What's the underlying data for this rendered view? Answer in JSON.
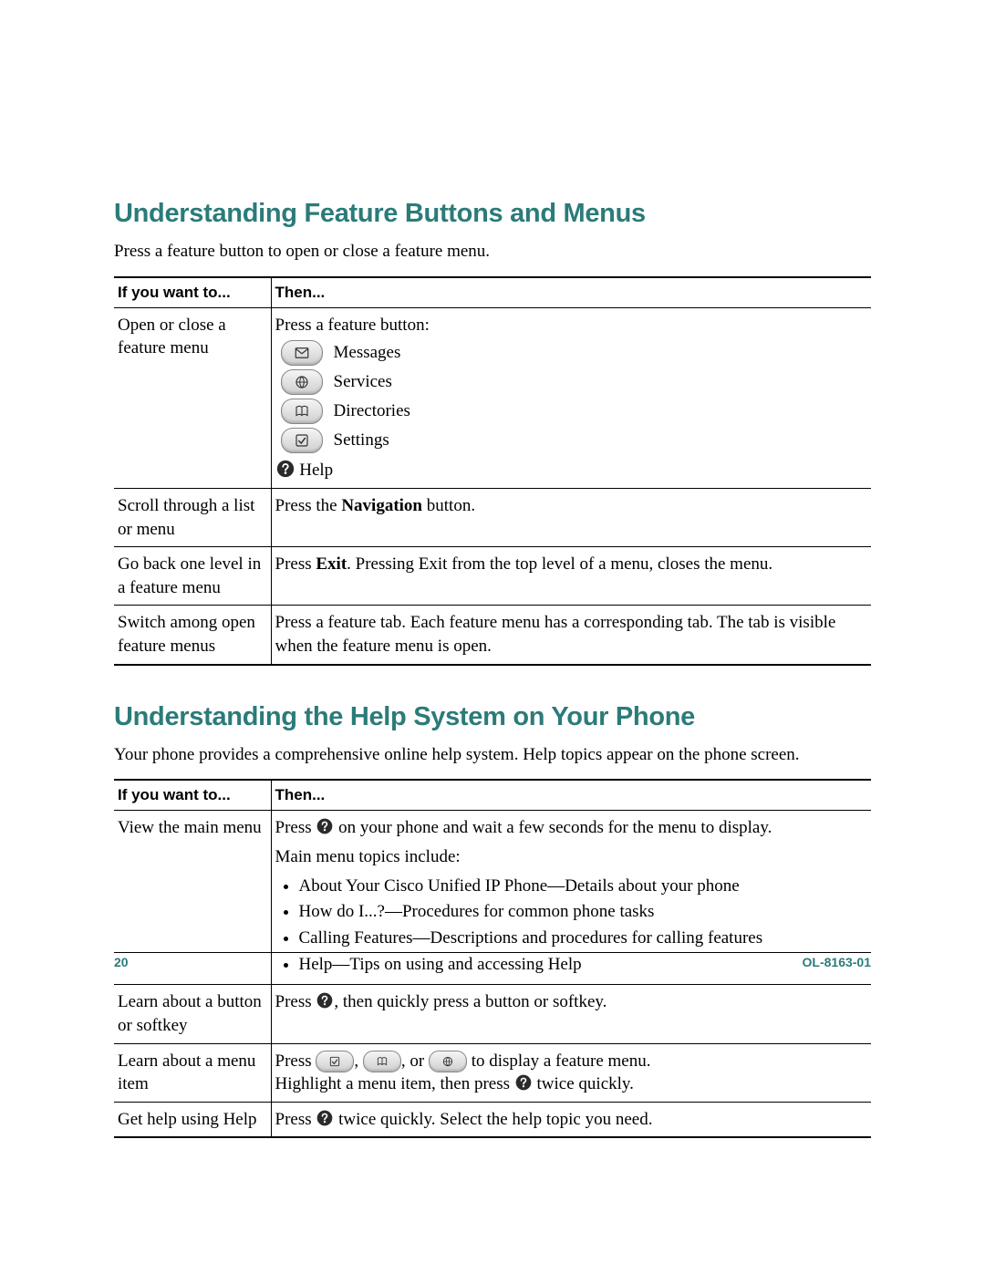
{
  "section1": {
    "heading": "Understanding Feature Buttons and Menus",
    "intro": "Press a feature button to open or close a feature menu."
  },
  "table1": {
    "head": {
      "c1": "If you want to...",
      "c2": "Then..."
    },
    "r1": {
      "left": "Open or close a feature menu",
      "lead": "Press a feature button:",
      "items": [
        "Messages",
        "Services",
        "Directories",
        "Settings"
      ],
      "help": "Help"
    },
    "r2": {
      "left": "Scroll through a list or menu",
      "right_pre": "Press the ",
      "right_bold": "Navigation",
      "right_post": " button."
    },
    "r3": {
      "left": "Go back one level in a feature menu",
      "right_pre": "Press ",
      "right_bold": "Exit",
      "right_post": ". Pressing Exit from the top level of a menu, closes the menu."
    },
    "r4": {
      "left": "Switch among open feature menus",
      "right": "Press a feature tab. Each feature menu has a corresponding tab. The tab is visible when the feature menu is open."
    }
  },
  "section2": {
    "heading": "Understanding the Help System on Your Phone",
    "intro": "Your phone provides a comprehensive online help system. Help topics appear on the phone screen."
  },
  "table2": {
    "head": {
      "c1": "If you want to...",
      "c2": "Then..."
    },
    "r1": {
      "left": "View the main menu",
      "line1_pre": "Press ",
      "line1_post": " on your phone and wait a few seconds for the menu to display.",
      "line2": "Main menu topics include:",
      "bullets": [
        "About Your Cisco Unified IP Phone—Details about your phone",
        "How do I...?—Procedures for common phone tasks",
        "Calling Features—Descriptions and procedures for calling features",
        "Help—Tips on using and accessing Help"
      ]
    },
    "r2": {
      "left": "Learn about a button or softkey",
      "pre": "Press ",
      "post": ", then quickly press a button or softkey."
    },
    "r3": {
      "left": "Learn about a menu item",
      "pre": "Press ",
      "mid1": ", ",
      "mid_or": ", or ",
      "mid2": " to display a feature menu.",
      "line2_pre": "Highlight a menu item, then press ",
      "line2_post": " twice quickly."
    },
    "r4": {
      "left": "Get help using Help",
      "pre": "Press ",
      "post": " twice quickly. Select the help topic you need."
    }
  },
  "footer": {
    "page": "20",
    "doc": "OL-8163-01"
  }
}
